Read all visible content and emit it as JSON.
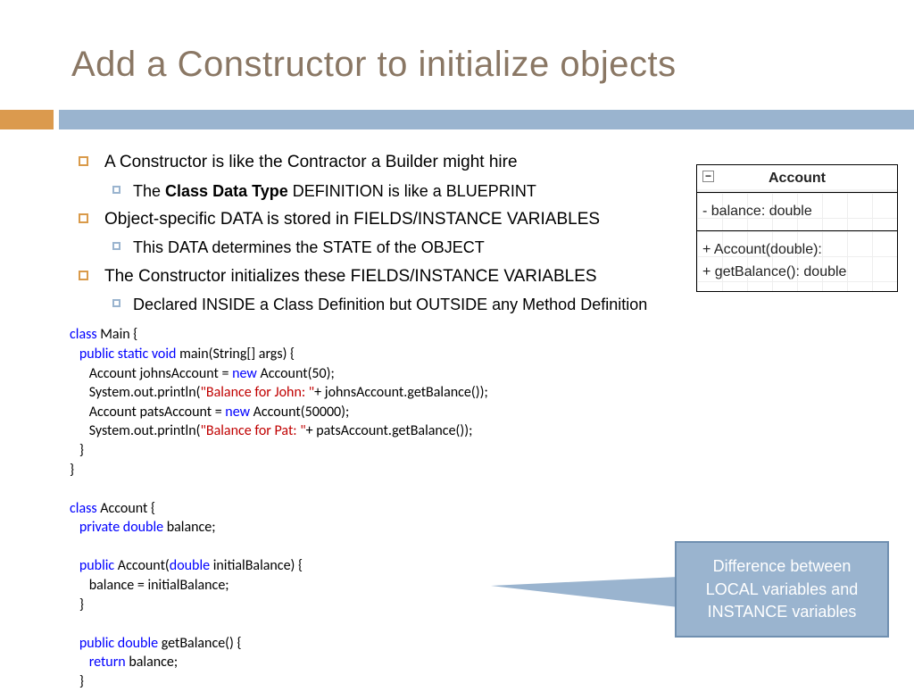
{
  "title": "Add a Constructor to initialize objects",
  "bullets": {
    "b1": "A Constructor is like the Contractor a Builder might hire",
    "b1a_pre": "The ",
    "b1a_bold": "Class Data Type",
    "b1a_post": " DEFINITION is like a BLUEPRINT",
    "b2": "Object-specific DATA is stored in FIELDS/INSTANCE VARIABLES",
    "b2a": "This DATA determines the STATE of the OBJECT",
    "b3": "The Constructor initializes these FIELDS/INSTANCE VARIABLES",
    "b3a": "Declared INSIDE a Class Definition but OUTSIDE any Method Definition"
  },
  "uml": {
    "name": "Account",
    "field": "- balance: double",
    "ctor": "+ Account(double):",
    "method": "+ getBalance(): double"
  },
  "code": {
    "l1a": "class",
    "l1b": " Main {",
    "l2a": "   public static void",
    "l2b": " main(String[] args) {",
    "l3a": "      Account johnsAccount = ",
    "l3b": "new",
    "l3c": " Account(50);",
    "l4a": "      System.out.println(",
    "l4b": "\"Balance for John: \"",
    "l4c": "+ johnsAccount.getBalance());",
    "l5a": "      Account patsAccount = ",
    "l5b": "new",
    "l5c": " Account(50000);",
    "l6a": "      System.out.println(",
    "l6b": "\"Balance for Pat: \"",
    "l6c": "+ patsAccount.getBalance());",
    "l7": "   }",
    "l8": "}",
    "blank": "",
    "l9a": "class",
    "l9b": " Account {",
    "l10a": "   private double",
    "l10b": " balance;",
    "l11a": "   public",
    "l11b": " Account(",
    "l11c": "double",
    "l11d": " initialBalance) {",
    "l12": "      balance = initialBalance;",
    "l13": "   }",
    "l14a": "   public double",
    "l14b": " getBalance() {",
    "l15a": "      return",
    "l15b": " balance;",
    "l16": "   }"
  },
  "callout": {
    "l1": "Difference between",
    "l2": "LOCAL variables and",
    "l3": "INSTANCE variables"
  }
}
